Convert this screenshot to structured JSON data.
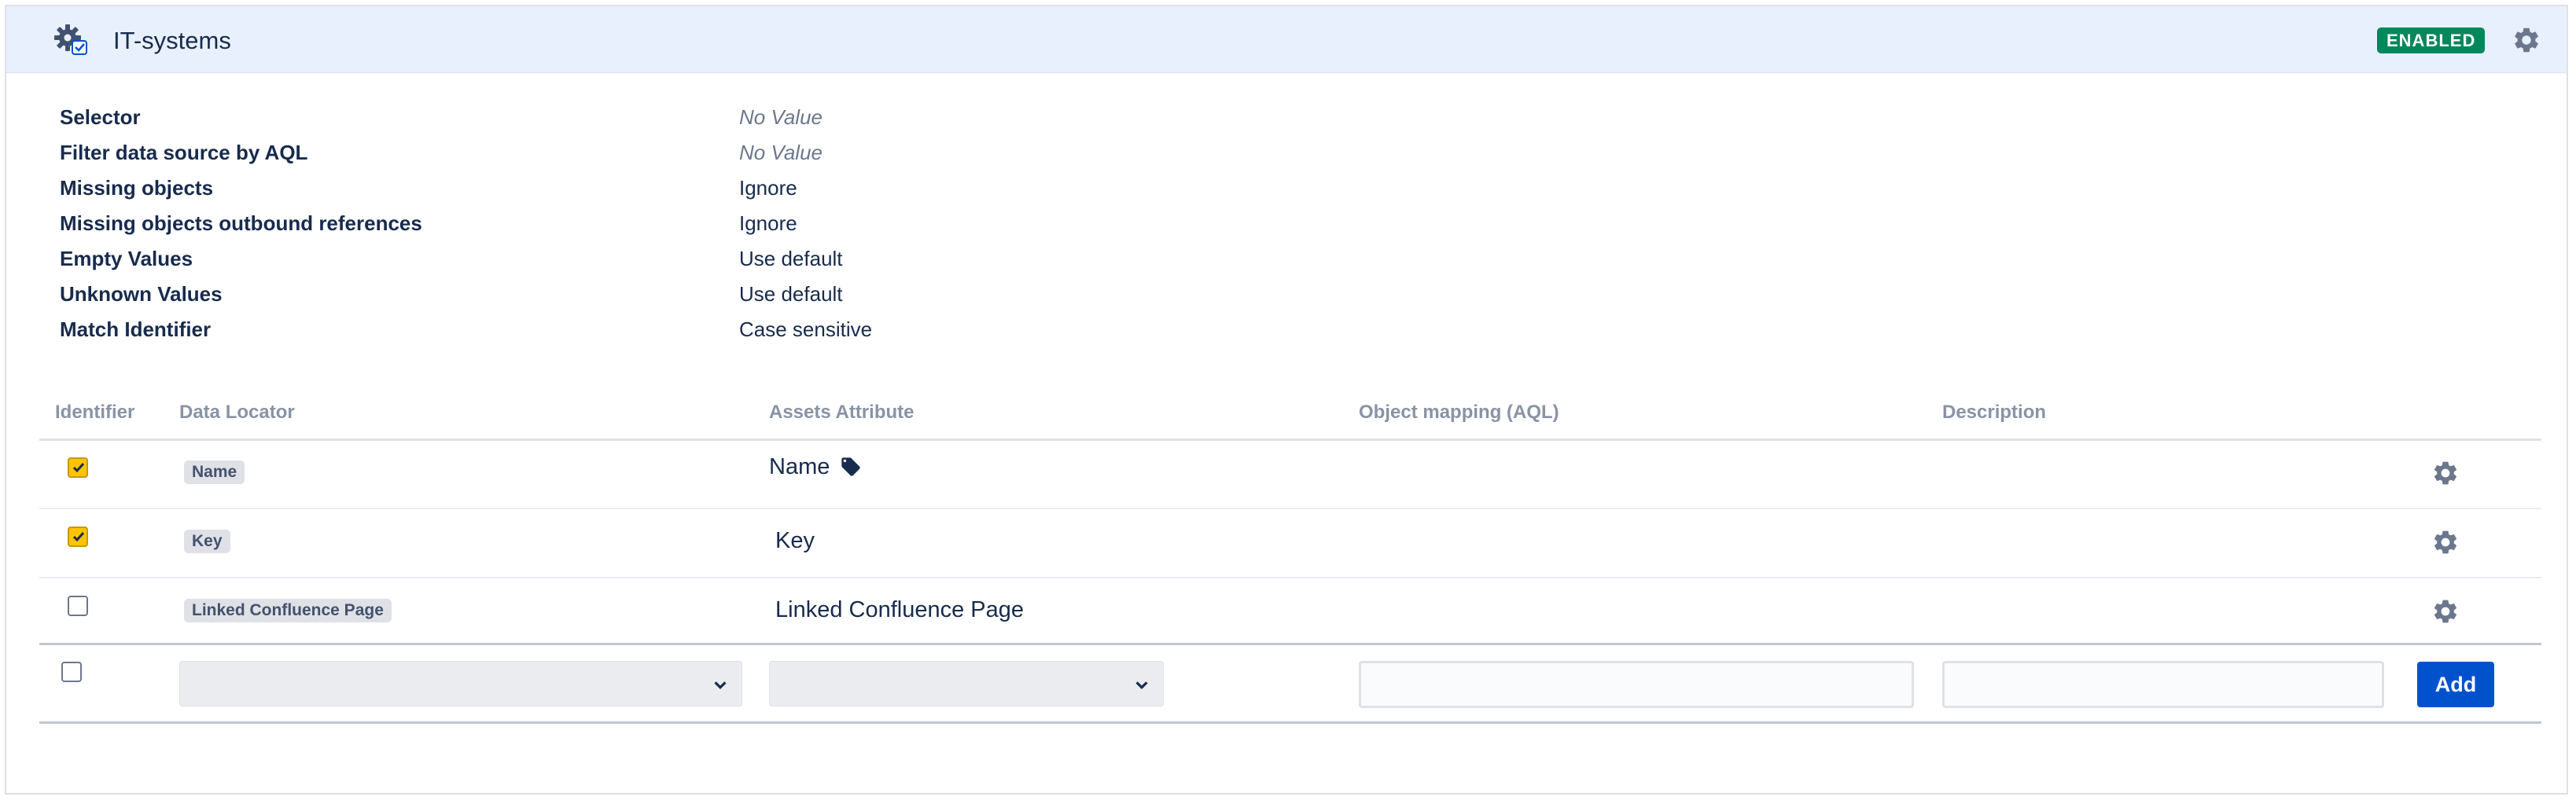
{
  "header": {
    "title": "IT-systems",
    "status": "ENABLED",
    "icon": "settings-gear-with-check-icon",
    "settings_icon": "gear-icon"
  },
  "properties": [
    {
      "label": "Selector",
      "value": "No Value",
      "empty": true
    },
    {
      "label": "Filter data source by AQL",
      "value": "No Value",
      "empty": true
    },
    {
      "label": "Missing objects",
      "value": "Ignore",
      "empty": false
    },
    {
      "label": "Missing objects outbound references",
      "value": "Ignore",
      "empty": false
    },
    {
      "label": "Empty Values",
      "value": "Use default",
      "empty": false
    },
    {
      "label": "Unknown Values",
      "value": "Use default",
      "empty": false
    },
    {
      "label": "Match Identifier",
      "value": "Case sensitive",
      "empty": false
    }
  ],
  "table": {
    "columns": [
      "Identifier",
      "Data Locator",
      "Assets Attribute",
      "Object mapping (AQL)",
      "Description"
    ],
    "rows": [
      {
        "identifier": true,
        "data_locator": "Name",
        "attribute": "Name",
        "attribute_icon": "tag-icon"
      },
      {
        "identifier": true,
        "data_locator": "Key",
        "attribute": "Key"
      },
      {
        "identifier": false,
        "data_locator": "Linked Confluence Page",
        "attribute": "Linked Confluence Page"
      }
    ],
    "new_row": {
      "identifier": false,
      "data_locator_selected": "",
      "attribute_selected": "",
      "object_mapping": "",
      "description": "",
      "add_label": "Add"
    }
  },
  "colors": {
    "header_bg": "#e9f0fd",
    "enabled_badge": "#00875a",
    "checkbox_checked": "#ffc400",
    "primary_button": "#0052cc"
  }
}
